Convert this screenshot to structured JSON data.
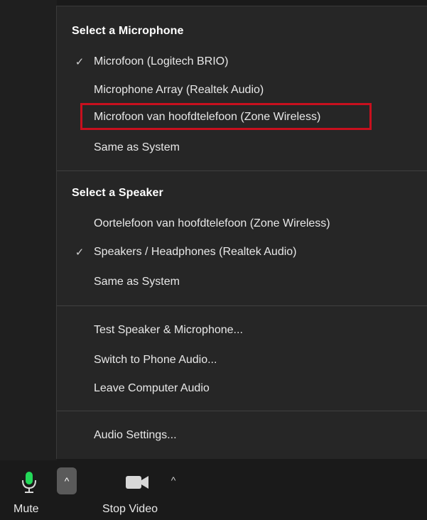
{
  "menu": {
    "microphone": {
      "title": "Select a Microphone",
      "items": [
        {
          "label": "Microfoon (Logitech BRIO)",
          "checked": true
        },
        {
          "label": "Microphone Array (Realtek Audio)",
          "checked": false
        },
        {
          "label": "Microfoon van hoofdtelefoon (Zone Wireless)",
          "checked": false,
          "highlighted": true
        },
        {
          "label": "Same as System",
          "checked": false
        }
      ]
    },
    "speaker": {
      "title": "Select a Speaker",
      "items": [
        {
          "label": "Oortelefoon van hoofdtelefoon (Zone Wireless)",
          "checked": false
        },
        {
          "label": "Speakers / Headphones (Realtek Audio)",
          "checked": true
        },
        {
          "label": "Same as System",
          "checked": false
        }
      ]
    },
    "actions": [
      {
        "label": "Test Speaker & Microphone..."
      },
      {
        "label": "Switch to Phone Audio..."
      },
      {
        "label": "Leave Computer Audio"
      }
    ],
    "settings": {
      "label": "Audio Settings..."
    },
    "check_glyph": "✓",
    "highlight_color": "#c8101e"
  },
  "toolbar": {
    "mute_label": "Mute",
    "stop_video_label": "Stop Video",
    "caret_glyph": "^",
    "mic_color": "#23d959"
  }
}
